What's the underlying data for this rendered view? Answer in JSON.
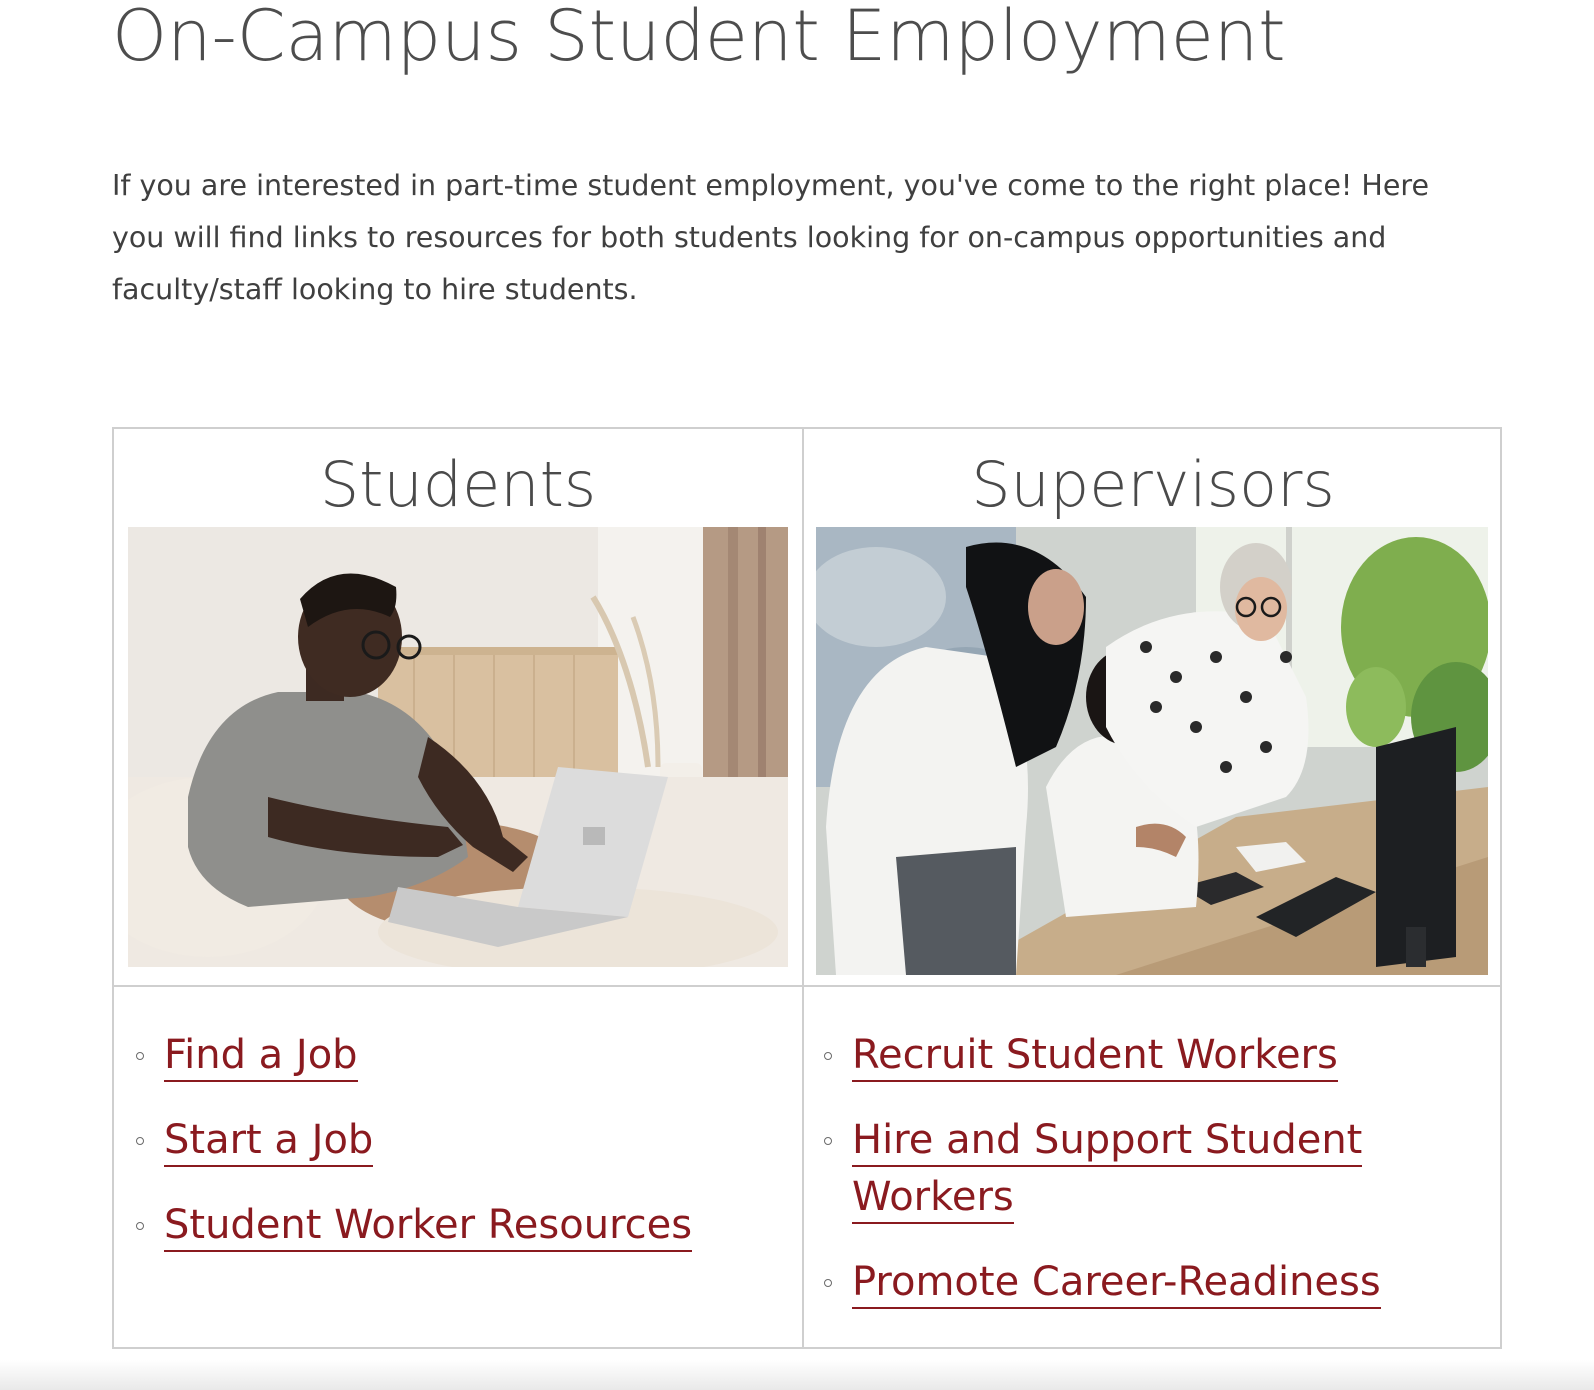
{
  "page": {
    "title": "On-Campus Student Employment",
    "intro": "If you are interested in part-time student employment, you've come to the right place! Here you will find links to resources for both students looking for on-campus opportunities and faculty/staff looking to hire students."
  },
  "students": {
    "heading": "Students",
    "links": [
      "Find a Job",
      "Start a Job",
      "Student Worker Resources"
    ]
  },
  "supervisors": {
    "heading": "Supervisors",
    "links": [
      "Recruit Student Workers",
      "Hire and Support Student Workers",
      "Promote Career-Readiness"
    ]
  },
  "colors": {
    "link": "#8a1a1f",
    "text": "#4a4a4a",
    "border": "#cfcfcf"
  }
}
